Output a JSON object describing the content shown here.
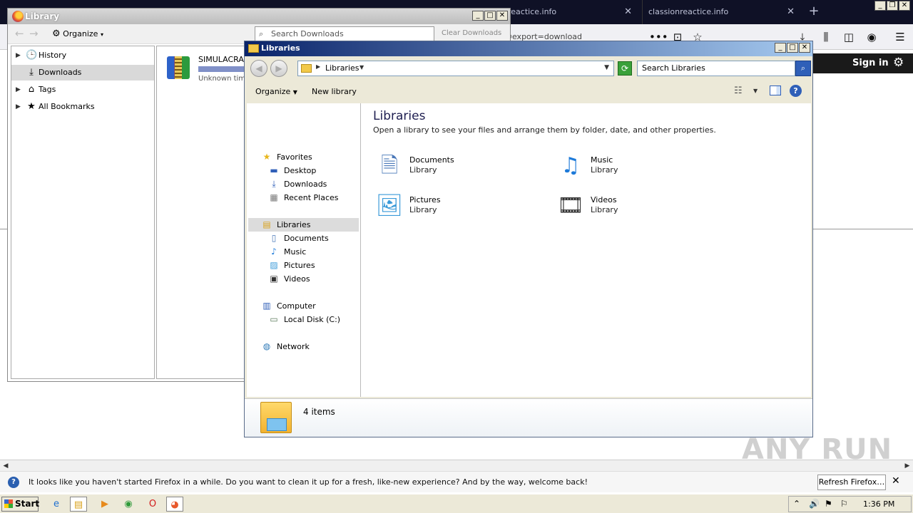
{
  "firefox": {
    "tabs": [
      {
        "label": "reactice.info"
      },
      {
        "label": "classionreactice.info"
      }
    ],
    "close_glyph": "✕",
    "newtab_glyph": "+",
    "url_fragment": "d@export=download",
    "page_header": {
      "signin": "Sign in"
    },
    "notification": {
      "text": "It looks like you haven't started Firefox in a while. Do you want to clean it up for a fresh, like-new experience? And by the way, welcome back!",
      "button": "Refresh Firefox…"
    },
    "watermark": "ANY RUN"
  },
  "library_window": {
    "title": "Library",
    "organize": "Organize",
    "search_placeholder": "Search Downloads",
    "clear_downloads": "Clear Downloads",
    "sidebar": [
      {
        "label": "History",
        "icon": "clock-icon"
      },
      {
        "label": "Downloads",
        "icon": "download-icon"
      },
      {
        "label": "Tags",
        "icon": "tag-icon"
      },
      {
        "label": "All Bookmarks",
        "icon": "star-icon"
      }
    ],
    "download": {
      "name": "SIMULACRA.r",
      "status": "Unknown time"
    }
  },
  "explorer_window": {
    "title": "Libraries",
    "address": "Libraries",
    "search_placeholder": "Search Libraries",
    "commands": {
      "organize": "Organize",
      "new_library": "New library"
    },
    "nav": {
      "favorites": "Favorites",
      "favorites_items": [
        "Desktop",
        "Downloads",
        "Recent Places"
      ],
      "libraries": "Libraries",
      "libraries_items": [
        "Documents",
        "Music",
        "Pictures",
        "Videos"
      ],
      "computer": "Computer",
      "computer_items": [
        "Local Disk (C:)"
      ],
      "network": "Network"
    },
    "content": {
      "title": "Libraries",
      "subtitle": "Open a library to see your files and arrange them by folder, date, and other properties.",
      "tiles": [
        {
          "name": "Documents",
          "type": "Library",
          "icon": "documents-library-icon"
        },
        {
          "name": "Music",
          "type": "Library",
          "icon": "music-library-icon"
        },
        {
          "name": "Pictures",
          "type": "Library",
          "icon": "pictures-library-icon"
        },
        {
          "name": "Videos",
          "type": "Library",
          "icon": "videos-library-icon"
        }
      ]
    },
    "details": "4 items"
  },
  "taskbar": {
    "start": "Start",
    "clock": "1:36 PM"
  }
}
